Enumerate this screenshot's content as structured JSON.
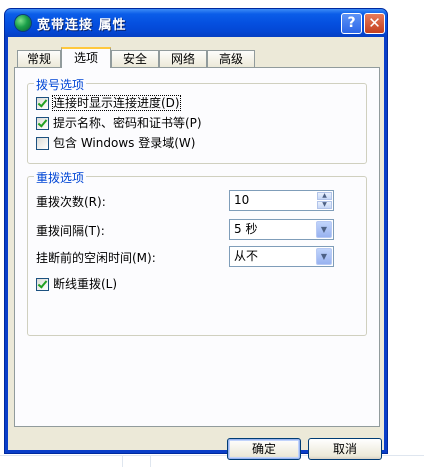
{
  "window": {
    "title": "宽带连接 属性"
  },
  "titlebar": {
    "help_glyph": "?",
    "close_glyph": "✕",
    "help_icon": "help-icon",
    "close_icon": "close-icon"
  },
  "tabs": [
    {
      "label": "常规",
      "active": false
    },
    {
      "label": "选项",
      "active": true
    },
    {
      "label": "安全",
      "active": false
    },
    {
      "label": "网络",
      "active": false
    },
    {
      "label": "高级",
      "active": false
    }
  ],
  "dial_options": {
    "title": "拨号选项",
    "items": [
      {
        "label": "连接时显示连接进度(D)",
        "checked": true
      },
      {
        "label": "提示名称、密码和证书等(P)",
        "checked": true
      },
      {
        "label": "包含 Windows 登录域(W)",
        "checked": false
      }
    ]
  },
  "redial_options": {
    "title": "重拨选项",
    "attempts": {
      "label": "重拨次数(R):",
      "value": "10"
    },
    "interval": {
      "label": "重拨间隔(T):",
      "value": "5 秒"
    },
    "idle": {
      "label": "挂断前的空闲时间(M):",
      "value": "从不"
    },
    "redial_if_dropped": {
      "label": "断线重拨(L)",
      "checked": true
    }
  },
  "buttons": {
    "ok": "确定",
    "cancel": "取消"
  }
}
